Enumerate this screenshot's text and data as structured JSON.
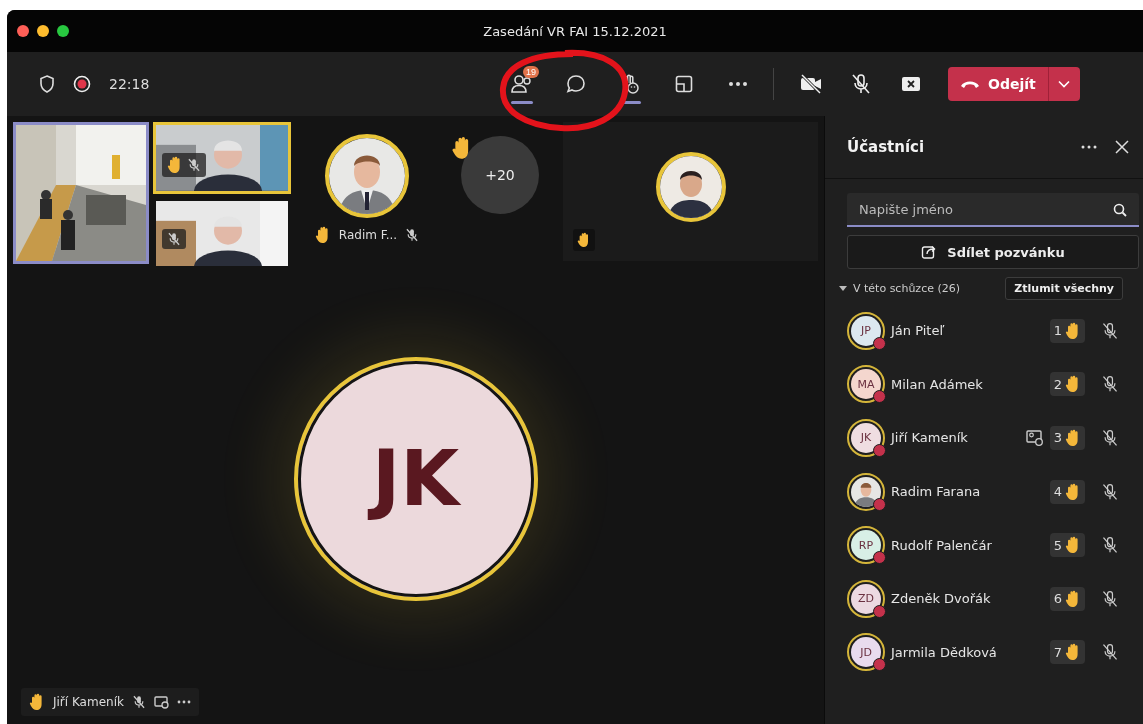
{
  "window": {
    "title": "Zasedání VR FAI 15.12.2021"
  },
  "toolbar": {
    "elapsed": "22:18",
    "recording": true,
    "buttons": [
      {
        "kind": "participants",
        "active": true,
        "badge": "19"
      },
      {
        "kind": "chat",
        "active": false
      },
      {
        "kind": "reactions",
        "active": true
      },
      {
        "kind": "rooms",
        "active": false
      },
      {
        "kind": "more",
        "active": false
      }
    ],
    "camera_on": false,
    "mic_on": false,
    "leave_label": "Odejít"
  },
  "gallery": {
    "videos": [
      {
        "selected": true,
        "speaking": false
      },
      {
        "selected": false,
        "speaking": true,
        "hand_raised": true,
        "muted": true
      },
      {
        "selected": false,
        "speaking": false,
        "hand_raised": false,
        "muted": true
      }
    ],
    "avatar_tile": {
      "name": "Radim F...",
      "hand_raised": true,
      "muted": true
    },
    "overflow": {
      "count": "+20",
      "hand_raised": true
    },
    "side_tile": {
      "hand_raised": true
    }
  },
  "stage": {
    "initials": "JK",
    "name": "Jiří Kameník",
    "hand_raised": true,
    "muted": true,
    "sharing": true
  },
  "panel": {
    "title": "Účastníci",
    "search_placeholder": "Napište jméno",
    "share_label": "Sdílet pozvánku",
    "section": {
      "label": "V této schůzce (26)",
      "expanded": true,
      "mute_all": "Ztlumit všechny"
    },
    "participants": [
      {
        "kind": "initials",
        "initials": "JP",
        "name": "Ján Piteľ",
        "color": "#dce8f0",
        "order": "1",
        "sharing": false,
        "muted": true
      },
      {
        "kind": "initials",
        "initials": "MA",
        "name": "Milan Adámek",
        "color": "#f4d6ce",
        "order": "2",
        "sharing": false,
        "muted": true
      },
      {
        "kind": "initials",
        "initials": "JK",
        "name": "Jiří Kameník",
        "color": "#efdde1",
        "order": "3",
        "sharing": true,
        "muted": true
      },
      {
        "name": "Radim Farana",
        "order": "4",
        "sharing": false,
        "muted": true
      },
      {
        "kind": "initials",
        "initials": "RP",
        "name": "Rudolf Palenčár",
        "color": "#d8efe6",
        "order": "5",
        "sharing": false,
        "muted": true
      },
      {
        "kind": "initials",
        "initials": "ZD",
        "name": "Zdeněk Dvořák",
        "color": "#ecd9e1",
        "order": "6",
        "sharing": false,
        "muted": true
      },
      {
        "kind": "initials",
        "initials": "JD",
        "name": "Jarmila Dědková",
        "color": "#e9dbee",
        "order": "7",
        "sharing": false,
        "muted": true
      }
    ]
  }
}
